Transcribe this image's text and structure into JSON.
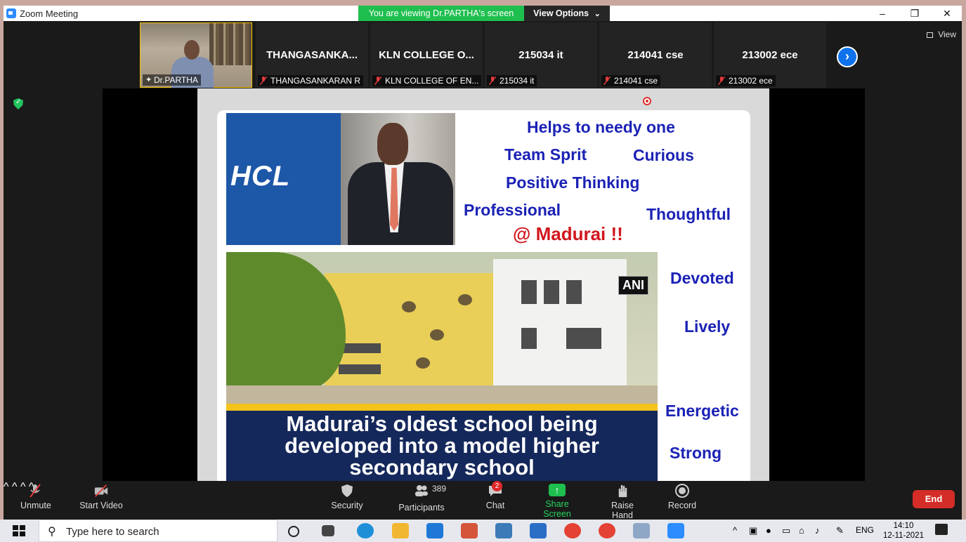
{
  "window": {
    "title": "Zoom Meeting",
    "viewing_banner": "You are viewing Dr.PARTHA's screen",
    "view_options": "View Options",
    "view_options_caret": "⌄",
    "minimize": "–",
    "maximize": "❐",
    "close": "✕"
  },
  "participants_strip": {
    "tiles": [
      {
        "big": "",
        "small": "Dr.PARTHA"
      },
      {
        "big": "THANGASANKA...",
        "small": "THANGASANKARAN R"
      },
      {
        "big": "KLN COLLEGE O...",
        "small": "KLN COLLEGE OF EN..."
      },
      {
        "big": "215034 it",
        "small": "215034 it"
      },
      {
        "big": "214041 cse",
        "small": "214041 cse"
      },
      {
        "big": "213002 ece",
        "small": "213002 ece"
      }
    ],
    "next_arrow": "›",
    "view_label": "View"
  },
  "slide": {
    "hcl_logo": "HCL",
    "words": {
      "helps": "Helps to needy one",
      "team": "Team Sprit",
      "curious": "Curious",
      "positive": "Positive Thinking",
      "professional": "Professional",
      "thoughtful": "Thoughtful",
      "madurai": "@ Madurai !!",
      "devoted": "Devoted",
      "lively": "Lively",
      "energetic": "Energetic",
      "strong": "Strong"
    },
    "ani_tag": "ANI",
    "caption_lines": [
      "Madurai’s oldest school being",
      "developed into a model higher",
      "secondary school"
    ]
  },
  "toolbar": {
    "unmute": "Unmute",
    "start_video": "Start Video",
    "security": "Security",
    "participants": "Participants",
    "participants_count": "389",
    "chat": "Chat",
    "chat_badge": "2",
    "share_screen": "Share Screen",
    "raise_hand": "Raise Hand",
    "record": "Record",
    "end": "End",
    "caret": "^"
  },
  "taskbar": {
    "search_placeholder": "Type here to search",
    "language": "ENG",
    "time": "14:10",
    "date": "12-11-2021"
  },
  "colors": {
    "accent_green": "#1fbf4f",
    "zoom_blue": "#0e72ed",
    "end_red": "#d42c27",
    "slide_blue_text": "#1b22b5",
    "slide_red_text": "#d1171e"
  }
}
